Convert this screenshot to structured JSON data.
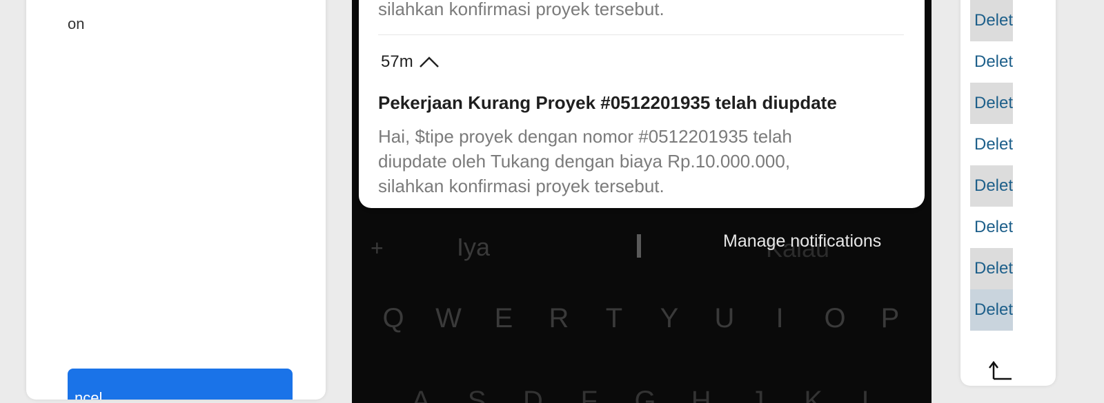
{
  "left_panel": {
    "text_fragment": "on",
    "button_partial_label": "ncel"
  },
  "notification_prev": {
    "body_tail": "silahkan konfirmasi proyek tersebut."
  },
  "notification": {
    "time": "57m",
    "title": "Pekerjaan Kurang Proyek #0512201935 telah diupdate",
    "body_lines": [
      "Hai, $tipe proyek dengan nomor #0512201935 telah",
      "diupdate oleh Tukang dengan biaya Rp.10.000.000,",
      "silahkan konfirmasi proyek tersebut."
    ]
  },
  "manage_notifications": "Manage notifications",
  "keyboard": {
    "suggestions": {
      "left": "+",
      "middle": "Iya",
      "right": "Kalau"
    },
    "row1": [
      "Q",
      "W",
      "E",
      "R",
      "T",
      "Y",
      "U",
      "I",
      "O",
      "P"
    ],
    "row2": [
      "A",
      "S",
      "D",
      "F",
      "G",
      "H",
      "J",
      "K",
      "L"
    ]
  },
  "right_panel": {
    "items": [
      {
        "label": "Delet"
      },
      {
        "label": "Delet"
      },
      {
        "label": "Delet"
      },
      {
        "label": "Delet"
      },
      {
        "label": "Delet"
      },
      {
        "label": "Delet"
      },
      {
        "label": "Delet"
      },
      {
        "label": "Delet"
      }
    ]
  },
  "colors": {
    "primary_button": "#1a73e8",
    "link": "#1d5f8a",
    "phone_bg": "#0a0a0a"
  }
}
